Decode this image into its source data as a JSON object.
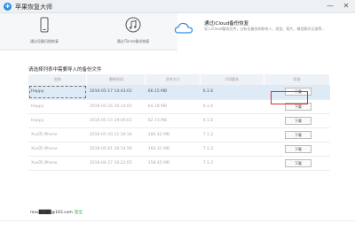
{
  "app": {
    "title": "苹果恢复大师"
  },
  "window_controls": {
    "min": "—",
    "close": "✕"
  },
  "modes": [
    {
      "label": "通过设备扫描恢复"
    },
    {
      "label": "通过iTunes备份恢复"
    }
  ],
  "active_mode": {
    "title": "通过iCloud备份恢复",
    "desc": "导入iCloud备份文件，分析出备份的联系人、短信、照片、微信聊天记录等..."
  },
  "caption": "请选择列表中需要导入的备份文件",
  "table": {
    "headers": [
      "名称",
      "更新时间",
      "文件大小",
      "iOS版本",
      "状态"
    ],
    "rows": [
      {
        "name": "Happy",
        "time": "2016-05-17 14:43:01",
        "size": "66.15 MB",
        "ios": "6.1.6",
        "action": "下载"
      },
      {
        "name": "Happy",
        "time": "2016-05-16 16:14:05",
        "size": "64.18 MB",
        "ios": "6.1.6",
        "action": "下载"
      },
      {
        "name": "Happy",
        "time": "2016-05-15 19:00:01",
        "size": "62.73 MB",
        "ios": "6.1.6",
        "action": "下载"
      },
      {
        "name": "Xxx的 iPhone",
        "time": "2016-05-10 11:16:34",
        "size": "180.42 MB",
        "ios": "7.1.2",
        "action": "下载"
      },
      {
        "name": "Xxx的 iPhone",
        "time": "2016-05-01 16:14:56",
        "size": "160.31 MB",
        "ios": "7.1.2",
        "action": "下载"
      },
      {
        "name": "Xxx的 iPhone",
        "time": "2016-04-27 16:22:05",
        "size": "158.45 MB",
        "ios": "7.1.2",
        "action": "下载"
      }
    ]
  },
  "account": {
    "email": "mov████@163.com",
    "logout": "登出"
  }
}
